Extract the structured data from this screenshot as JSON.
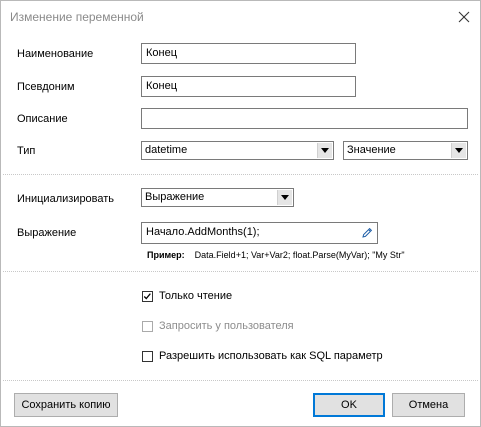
{
  "window": {
    "title": "Изменение переменной"
  },
  "form": {
    "name_label": "Наименование",
    "name_value": "Конец",
    "alias_label": "Псевдоним",
    "alias_value": "Конец",
    "description_label": "Описание",
    "description_value": "",
    "type_label": "Тип",
    "type_value": "datetime",
    "type_mode_value": "Значение",
    "init_label": "Инициализировать",
    "init_value": "Выражение",
    "expression_label": "Выражение",
    "expression_value": "Начало.AddMonths(1);",
    "example_label": "Пример:",
    "example_text": "Data.Field+1; Var+Var2; float.Parse(MyVar); \"My Str\""
  },
  "options": {
    "readonly_label": "Только чтение",
    "readonly_checked": true,
    "ask_user_label": "Запросить у пользователя",
    "ask_user_checked": false,
    "ask_user_enabled": false,
    "sql_param_label": "Разрешить использовать как SQL параметр",
    "sql_param_checked": false
  },
  "buttons": {
    "save_copy": "Сохранить копию",
    "ok": "OK",
    "cancel": "Отмена"
  },
  "colors": {
    "default_button_border": "#0078d7",
    "disabled_text": "#8d8d8d"
  }
}
